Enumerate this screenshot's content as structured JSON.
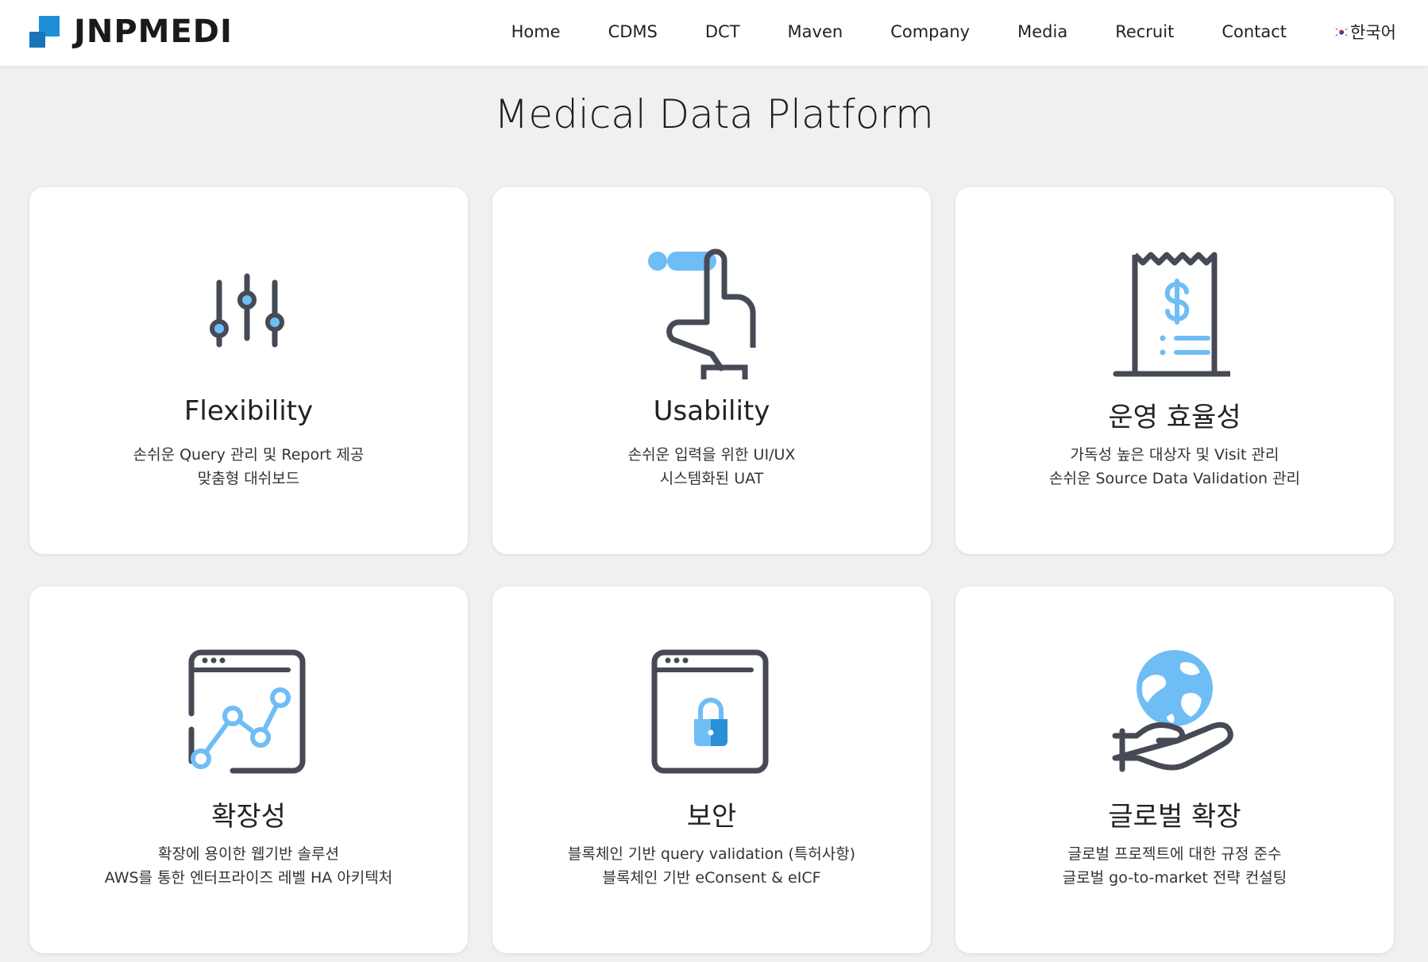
{
  "brand": {
    "name": "JNPMEDI"
  },
  "nav": {
    "items": [
      "Home",
      "CDMS",
      "DCT",
      "Maven",
      "Company",
      "Media",
      "Recruit",
      "Contact"
    ],
    "language": "한국어"
  },
  "page": {
    "title": "Medical Data Platform"
  },
  "cards": [
    {
      "title": "Flexibility",
      "lines": [
        "손쉬운 Query 관리 및 Report 제공",
        "맞춤형 대쉬보드"
      ],
      "icon": "sliders-icon"
    },
    {
      "title": "Usability",
      "lines": [
        "손쉬운 입력을 위한 UI/UX",
        "시스템화된 UAT"
      ],
      "icon": "pointing-hand-icon"
    },
    {
      "title": "운영 효율성",
      "lines": [
        "가독성 높은 대상자 및 Visit 관리",
        "손쉬운 Source Data Validation 관리"
      ],
      "icon": "receipt-dollar-icon"
    },
    {
      "title": "확장성",
      "lines": [
        "확장에 용이한 웹기반 솔루션",
        "AWS를 통한 엔터프라이즈 레벨 HA 아키텍처"
      ],
      "icon": "browser-chart-icon"
    },
    {
      "title": "보안",
      "lines": [
        "블록체인 기반 query validation (특허사항)",
        "블록체인 기반 eConsent & eICF"
      ],
      "icon": "browser-lock-icon"
    },
    {
      "title": "글로벌 확장",
      "lines": [
        "글로벌 프로젝트에 대한 규정 준수",
        "글로벌 go-to-market 전략 컨설팅"
      ],
      "icon": "globe-hand-icon"
    }
  ],
  "colors": {
    "accent": "#6fbdf5",
    "icon_stroke": "#454a55",
    "logo_blue": "#1e8fd8"
  }
}
